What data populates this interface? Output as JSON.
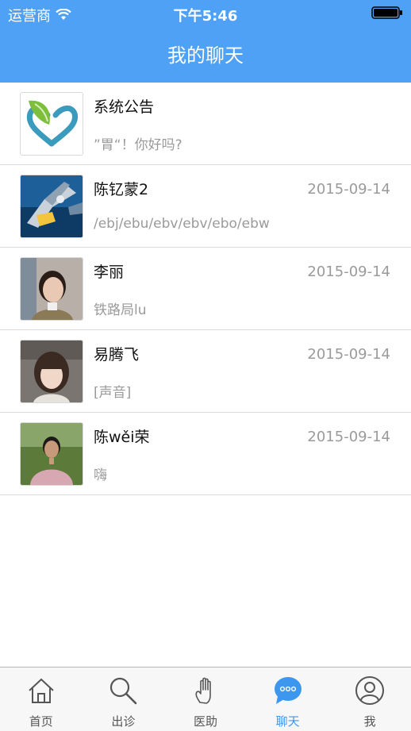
{
  "status_bar": {
    "carrier": "运营商",
    "time": "下午5:46"
  },
  "header": {
    "title": "我的聊天"
  },
  "chats": [
    {
      "name": "系统公告",
      "date": "",
      "preview": "”胃“！你好吗?"
    },
    {
      "name": "陈钇蒙2",
      "date": "2015-09-14",
      "preview": "/ebj/ebu/ebv/ebv/ebo/ebw"
    },
    {
      "name": "李丽",
      "date": "2015-09-14",
      "preview": "铁路局lu"
    },
    {
      "name": "易腾飞",
      "date": "2015-09-14",
      "preview": "[声音]"
    },
    {
      "name": "陈wěi荣",
      "date": "2015-09-14",
      "preview": "嗨"
    }
  ],
  "tabs": [
    {
      "label": "首页",
      "icon": "home-icon"
    },
    {
      "label": "出诊",
      "icon": "search-icon"
    },
    {
      "label": "医助",
      "icon": "hand-icon"
    },
    {
      "label": "聊天",
      "icon": "chat-bubble-icon",
      "active": true
    },
    {
      "label": "我",
      "icon": "user-icon"
    }
  ],
  "colors": {
    "header": "#4ea1f4",
    "active_tab": "#3d97ee",
    "muted_text": "#9a9a9a"
  }
}
